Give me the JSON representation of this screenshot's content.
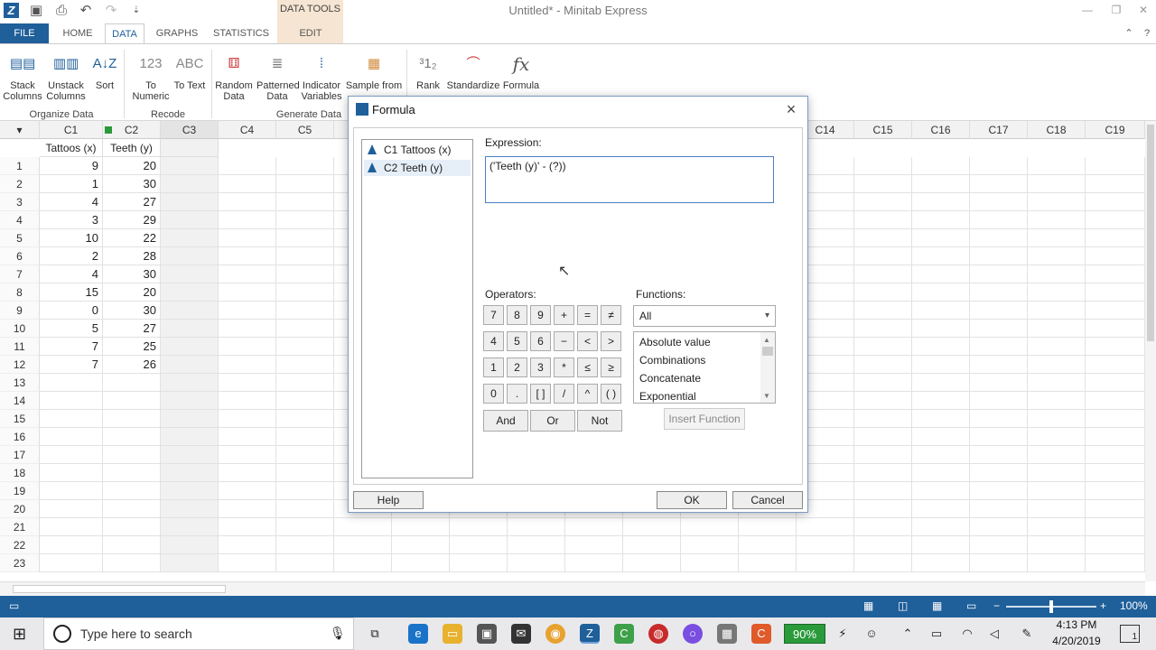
{
  "window": {
    "title": "Untitled* - Minitab Express"
  },
  "title_bar": {
    "app_logo_text": "Z",
    "data_tools_label": "DATA TOOLS"
  },
  "tabs": [
    "FILE",
    "HOME",
    "DATA",
    "GRAPHS",
    "STATISTICS",
    "EDIT"
  ],
  "ribbon": {
    "buttons": {
      "stack": "Stack Columns",
      "unstack": "Unstack Columns",
      "sort": "Sort",
      "to_numeric": "To Numeric",
      "to_text": "To Text",
      "random": "Random Data",
      "patterned": "Patterned Data",
      "indicator": "Indicator Variables",
      "sample": "Sample from",
      "rank": "Rank",
      "standardize": "Standardize",
      "formula": "Formula"
    },
    "icon_glyphs": {
      "numeric": "123",
      "text": "ABC",
      "formula": "fx"
    },
    "groups": {
      "organize": "Organize Data",
      "recode": "Recode",
      "generate": "Generate Data"
    }
  },
  "sheet": {
    "columns": [
      "C1",
      "C2",
      "C3",
      "C4",
      "C5",
      "C14",
      "C15",
      "C16",
      "C17",
      "C18",
      "C19"
    ],
    "names": [
      "Tattoos (x)",
      "Teeth (y)"
    ],
    "rows": [
      "1",
      "2",
      "3",
      "4",
      "5",
      "6",
      "7",
      "8",
      "9",
      "10",
      "11",
      "12",
      "13",
      "14",
      "15",
      "16",
      "17",
      "18",
      "19",
      "20",
      "21",
      "22",
      "23"
    ],
    "c1": [
      "9",
      "1",
      "4",
      "3",
      "10",
      "2",
      "4",
      "15",
      "0",
      "5",
      "7",
      "7"
    ],
    "c2": [
      "20",
      "30",
      "27",
      "29",
      "22",
      "28",
      "30",
      "20",
      "30",
      "27",
      "25",
      "26"
    ]
  },
  "dialog": {
    "title": "Formula",
    "variables": [
      "C1  Tattoos (x)",
      "C2  Teeth (y)"
    ],
    "expression_label": "Expression:",
    "expression": "('Teeth (y)' - (?))",
    "operators_label": "Operators:",
    "operators": [
      [
        "7",
        "8",
        "9",
        "+",
        "=",
        "≠"
      ],
      [
        "4",
        "5",
        "6",
        "−",
        "<",
        ">"
      ],
      [
        "1",
        "2",
        "3",
        "*",
        "≤",
        "≥"
      ],
      [
        "0",
        ".",
        "[ ]",
        "/",
        "^",
        "( )"
      ]
    ],
    "logic": [
      "And",
      "Or",
      "Not"
    ],
    "functions_label": "Functions:",
    "functions_selected": "All",
    "functions": [
      "Absolute value",
      "Combinations",
      "Concatenate",
      "Exponential"
    ],
    "insert_function": "Insert Function",
    "help": "Help",
    "ok": "OK",
    "cancel": "Cancel"
  },
  "status": {
    "zoom": "100%"
  },
  "taskbar": {
    "search_placeholder": "Type here to search",
    "battery": "90%",
    "time": "4:13 PM",
    "date": "4/20/2019",
    "notifications": "1"
  },
  "colors": {
    "brand": "#1f5f9a",
    "data_tools": "#f6e5d2"
  }
}
